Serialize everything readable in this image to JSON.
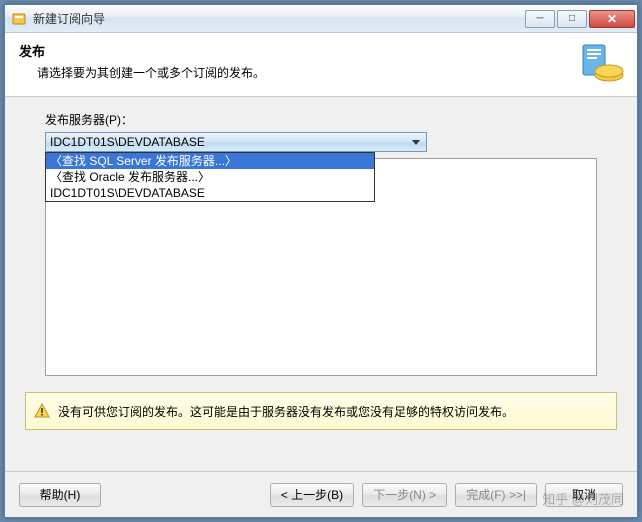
{
  "window": {
    "title": "新建订阅向导"
  },
  "header": {
    "title": "发布",
    "subtitle": "请选择要为其创建一个或多个订阅的发布。"
  },
  "publisher": {
    "label": "发布服务器(P)：",
    "selected": "IDC1DT01S\\DEVDATABASE",
    "options": [
      "〈查找 SQL Server 发布服务器...〉",
      "〈查找 Oracle 发布服务器...〉",
      "IDC1DT01S\\DEVDATABASE"
    ],
    "highlighted_index": 0
  },
  "warning": {
    "text": "没有可供您订阅的发布。这可能是由于服务器没有发布或您没有足够的特权访问发布。"
  },
  "buttons": {
    "help": "帮助(H)",
    "back": "< 上一步(B)",
    "next": "下一步(N) >",
    "finish": "完成(F) >>|",
    "cancel": "取消"
  },
  "watermark": "知乎 @刘茂同"
}
